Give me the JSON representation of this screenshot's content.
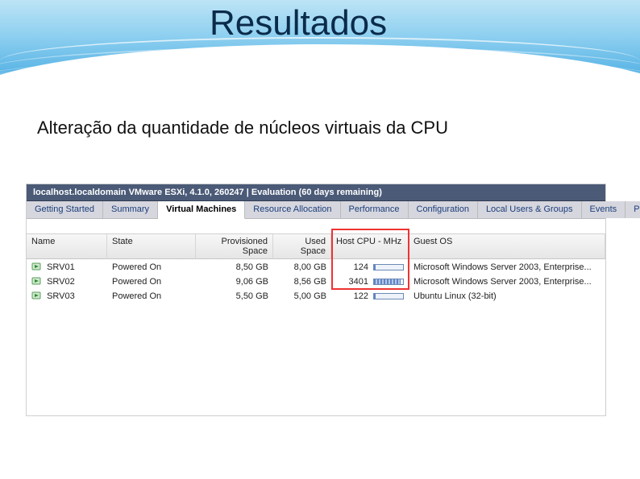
{
  "title": "Resultados",
  "subtitle": "Alteração da quantidade de núcleos virtuais da CPU",
  "screenshot": {
    "host_line": "localhost.localdomain VMware ESXi, 4.1.0, 260247 | Evaluation (60 days remaining)",
    "tabs": [
      "Getting Started",
      "Summary",
      "Virtual Machines",
      "Resource Allocation",
      "Performance",
      "Configuration",
      "Local Users & Groups",
      "Events",
      "Pe"
    ],
    "columns": [
      "Name",
      "State",
      "Provisioned Space",
      "Used Space",
      "Host CPU - MHz",
      "Guest OS"
    ],
    "rows": [
      {
        "name": "SRV01",
        "state": "Powered On",
        "provisioned": "8,50 GB",
        "used": "8,00 GB",
        "cpu_mhz": "124",
        "guest": "Microsoft Windows Server 2003, Enterprise..."
      },
      {
        "name": "SRV02",
        "state": "Powered On",
        "provisioned": "9,06 GB",
        "used": "8,56 GB",
        "cpu_mhz": "3401",
        "guest": "Microsoft Windows Server 2003, Enterprise..."
      },
      {
        "name": "SRV03",
        "state": "Powered On",
        "provisioned": "5,50 GB",
        "used": "5,00 GB",
        "cpu_mhz": "122",
        "guest": "Ubuntu Linux (32-bit)"
      }
    ],
    "highlighted_column": "Host CPU - MHz"
  }
}
